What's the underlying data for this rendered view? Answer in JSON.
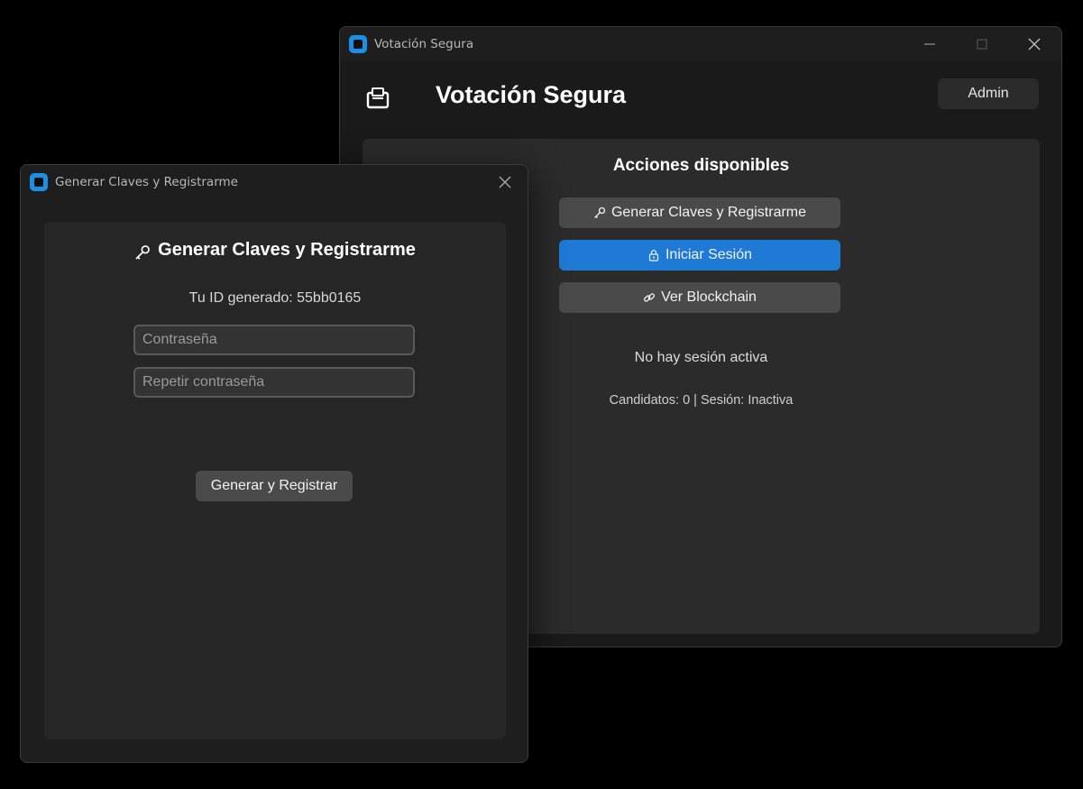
{
  "main_window": {
    "title": "Votación Segura",
    "header_title": "Votación Segura",
    "admin_button": "Admin",
    "panel_title": "Acciones disponibles",
    "actions": [
      {
        "label": "Generar Claves y Registrarme",
        "icon": "key-icon",
        "style": "grey"
      },
      {
        "label": "Iniciar Sesión",
        "icon": "lock-icon",
        "style": "blue"
      },
      {
        "label": "Ver Blockchain",
        "icon": "link-icon",
        "style": "grey"
      }
    ],
    "session_status": "No hay sesión activa",
    "status_line": "Candidatos: 0 | Sesión: Inactiva"
  },
  "dialog_window": {
    "title": "Generar Claves y Registrarme",
    "heading": "Generar Claves y Registrarme",
    "id_label": "Tu ID generado: 55bb0165",
    "password": {
      "value": "",
      "placeholder": "Contraseña"
    },
    "repeat_password": {
      "value": "",
      "placeholder": "Repetir contraseña"
    },
    "submit_button": "Generar y Registrar"
  },
  "colors": {
    "accent_blue": "#1f7ad6",
    "app_icon": "#1a8fe3",
    "button_grey": "#4a4a4a",
    "panel_bg": "#2b2b2b",
    "window_bg": "#1a1a1a"
  }
}
